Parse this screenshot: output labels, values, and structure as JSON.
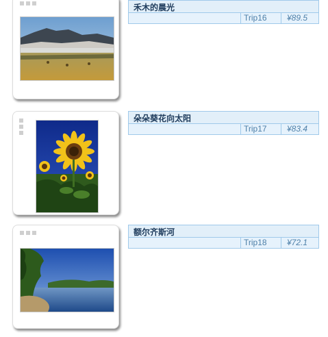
{
  "items": [
    {
      "title": "禾木的晨光",
      "trip": "Trip16",
      "price": "¥89.5",
      "photo_icon": "mountain-meadow-photo",
      "handle_icon": "drag-handle-icon"
    },
    {
      "title": "朵朵葵花向太阳",
      "trip": "Trip17",
      "price": "¥83.4",
      "photo_icon": "sunflower-photo",
      "handle_icon": "drag-handle-icon"
    },
    {
      "title": "额尔齐斯河",
      "trip": "Trip18",
      "price": "¥72.1",
      "photo_icon": "river-photo",
      "handle_icon": "drag-handle-icon"
    }
  ],
  "colors": {
    "header_bg": "#e2eff9",
    "border": "#9fc9ea",
    "title": "#1e3b5c",
    "meta": "#4d7fa8"
  }
}
